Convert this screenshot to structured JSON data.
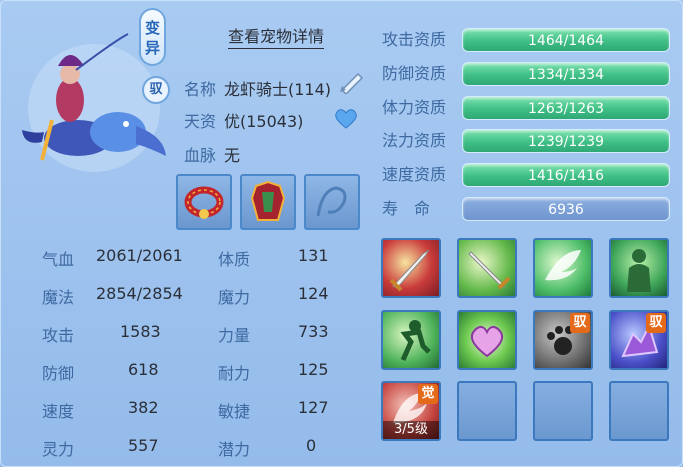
{
  "header": {
    "mutant_badge": "变异",
    "ride_badge": "驭",
    "detail_link": "查看宠物详情"
  },
  "info": {
    "name_label": "名称",
    "name_value": "龙虾骑士(114)",
    "aptitude_label": "天资",
    "aptitude_value": "优(15043)",
    "bloodline_label": "血脉",
    "bloodline_value": "无"
  },
  "qualities": [
    {
      "label": "攻击资质",
      "value": "1464/1464"
    },
    {
      "label": "防御资质",
      "value": "1334/1334"
    },
    {
      "label": "体力资质",
      "value": "1263/1263"
    },
    {
      "label": "法力资质",
      "value": "1239/1239"
    },
    {
      "label": "速度资质",
      "value": "1416/1416"
    },
    {
      "label": "寿　命",
      "value": "6936"
    }
  ],
  "stats_left": [
    {
      "label": "气血",
      "value": "2061/2061"
    },
    {
      "label": "魔法",
      "value": "2854/2854"
    },
    {
      "label": "攻击",
      "value": "1583"
    },
    {
      "label": "防御",
      "value": "618"
    },
    {
      "label": "速度",
      "value": "382"
    },
    {
      "label": "灵力",
      "value": "557"
    }
  ],
  "stats_right": [
    {
      "label": "体质",
      "value": "131"
    },
    {
      "label": "魔力",
      "value": "124"
    },
    {
      "label": "力量",
      "value": "733"
    },
    {
      "label": "耐力",
      "value": "125"
    },
    {
      "label": "敏捷",
      "value": "127"
    },
    {
      "label": "潜力",
      "value": "0"
    }
  ],
  "skills": {
    "yu_badge": "驭",
    "awaken_badge": "觉",
    "awaken_level": "3/5级"
  },
  "icons": [
    "edit-icon",
    "heart-icon"
  ],
  "colors": {
    "bar_green": "#3fbf86",
    "label_blue": "#3e6aa1",
    "badge_orange": "#e46a1a"
  }
}
